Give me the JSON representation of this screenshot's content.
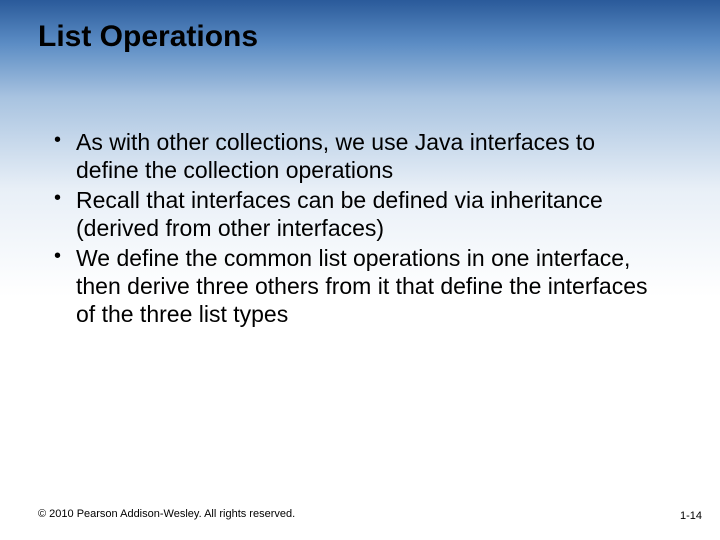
{
  "title": "List Operations",
  "bullets": [
    "As with other collections, we use Java interfaces to define the collection operations",
    "Recall that interfaces can be defined via inheritance (derived from other interfaces)",
    "We define the common list operations in one interface, then derive three others from it that define the interfaces of the three list types"
  ],
  "footer": {
    "copyright": "© 2010 Pearson Addison-Wesley. All rights reserved.",
    "page": "1-14"
  }
}
